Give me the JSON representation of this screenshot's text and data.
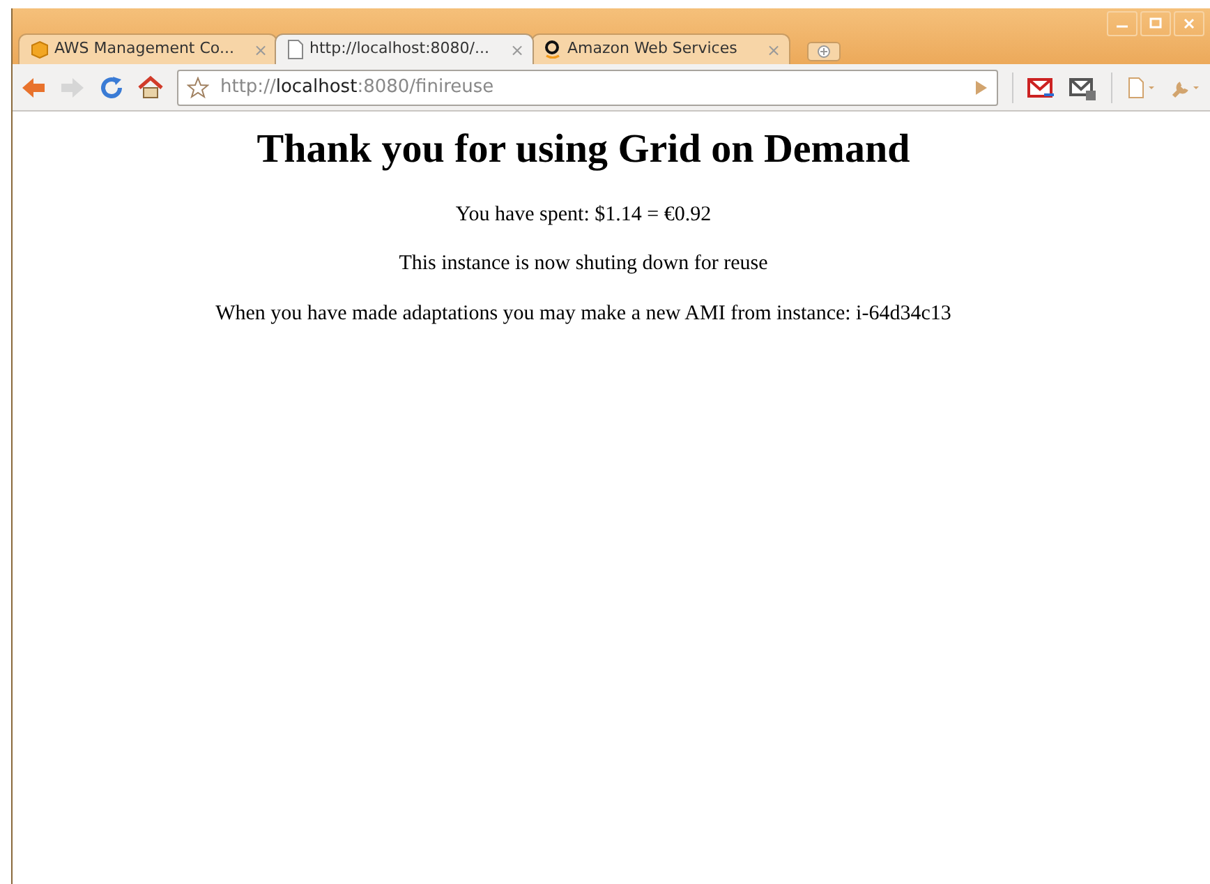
{
  "tabs": [
    {
      "label": "AWS Management Co...",
      "kind": "box",
      "close": "×",
      "selected": false
    },
    {
      "label": "http://localhost:8080/...",
      "kind": "page",
      "close": "×",
      "selected": true
    },
    {
      "label": "Amazon Web Services",
      "kind": "amazon",
      "close": "×",
      "selected": false
    }
  ],
  "address_bar": {
    "parts": [
      {
        "text": "http://",
        "kind": "dim"
      },
      {
        "text": "localhost",
        "kind": "host"
      },
      {
        "text": ":8080/finireuse",
        "kind": "dim"
      }
    ]
  },
  "page": {
    "heading": "Thank you for using Grid on Demand",
    "paragraphs": [
      "You have spent: $1.14 = €0.92",
      "This instance is now shuting down for reuse",
      "When you have made adaptations you may make a new AMI from instance: i-64d34c13"
    ]
  }
}
